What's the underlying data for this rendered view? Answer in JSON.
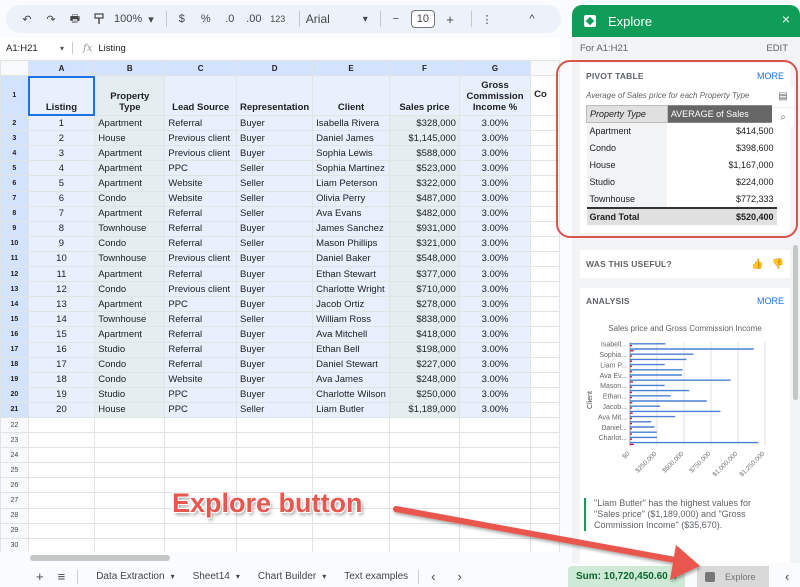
{
  "toolbar": {
    "undo": "↶",
    "redo": "↷",
    "print": "🖶",
    "paint_format": "⌨",
    "zoom": "100%",
    "currency": "$",
    "percent": "%",
    "decrease_decimal": ".0",
    "increase_decimal": ".00",
    "more_formats": "123",
    "font": "Arial",
    "font_size": "10",
    "minus": "−",
    "plus": "+",
    "more": "⋮",
    "collapse": "^"
  },
  "formula_bar": {
    "name_box": "A1:H21",
    "fx": "fx",
    "content": "Listing"
  },
  "grid": {
    "columns": [
      "A",
      "B",
      "C",
      "D",
      "E",
      "F",
      "G",
      ""
    ],
    "headers": [
      "Listing",
      "Property Type",
      "Lead Source",
      "Representation",
      "Client",
      "Sales price",
      "Gross Commission Income %",
      "Co"
    ],
    "rows": [
      [
        "1",
        "Apartment",
        "Referral",
        "Buyer",
        "Isabella Rivera",
        "$328,000",
        "3.00%"
      ],
      [
        "2",
        "House",
        "Previous client",
        "Buyer",
        "Daniel James",
        "$1,145,000",
        "3.00%"
      ],
      [
        "3",
        "Apartment",
        "Previous client",
        "Buyer",
        "Sophia Lewis",
        "$588,000",
        "3.00%"
      ],
      [
        "4",
        "Apartment",
        "PPC",
        "Seller",
        "Sophia Martinez",
        "$523,000",
        "3.00%"
      ],
      [
        "5",
        "Apartment",
        "Website",
        "Seller",
        "Liam Peterson",
        "$322,000",
        "3.00%"
      ],
      [
        "6",
        "Condo",
        "Website",
        "Seller",
        "Olivia Perry",
        "$487,000",
        "3.00%"
      ],
      [
        "7",
        "Apartment",
        "Referral",
        "Seller",
        "Ava Evans",
        "$482,000",
        "3.00%"
      ],
      [
        "8",
        "Townhouse",
        "Referral",
        "Buyer",
        "James Sanchez",
        "$931,000",
        "3.00%"
      ],
      [
        "9",
        "Condo",
        "Referral",
        "Seller",
        "Mason Phillips",
        "$321,000",
        "3.00%"
      ],
      [
        "10",
        "Townhouse",
        "Previous client",
        "Buyer",
        "Daniel Baker",
        "$548,000",
        "3.00%"
      ],
      [
        "11",
        "Apartment",
        "Referral",
        "Buyer",
        "Ethan Stewart",
        "$377,000",
        "3.00%"
      ],
      [
        "12",
        "Condo",
        "Previous client",
        "Buyer",
        "Charlotte Wright",
        "$710,000",
        "3.00%"
      ],
      [
        "13",
        "Apartment",
        "PPC",
        "Buyer",
        "Jacob Ortiz",
        "$278,000",
        "3.00%"
      ],
      [
        "14",
        "Townhouse",
        "Referral",
        "Seller",
        "William Ross",
        "$838,000",
        "3.00%"
      ],
      [
        "15",
        "Apartment",
        "Referral",
        "Buyer",
        "Ava Mitchell",
        "$418,000",
        "3.00%"
      ],
      [
        "16",
        "Studio",
        "Referral",
        "Buyer",
        "Ethan Bell",
        "$198,000",
        "3.00%"
      ],
      [
        "17",
        "Condo",
        "Referral",
        "Buyer",
        "Daniel Stewart",
        "$227,000",
        "3.00%"
      ],
      [
        "18",
        "Condo",
        "Website",
        "Buyer",
        "Ava James",
        "$248,000",
        "3.00%"
      ],
      [
        "19",
        "Studio",
        "PPC",
        "Buyer",
        "Charlotte Wilson",
        "$250,000",
        "3.00%"
      ],
      [
        "20",
        "House",
        "PPC",
        "Seller",
        "Liam Butler",
        "$1,189,000",
        "3.00%"
      ]
    ],
    "empty_row_numbers": [
      "22",
      "23",
      "24",
      "25",
      "26",
      "27",
      "28",
      "29",
      "30"
    ]
  },
  "explore": {
    "title": "Explore",
    "close": "×",
    "for_range": "For A1:H21",
    "edit": "EDIT",
    "pivot": {
      "title": "PIVOT TABLE",
      "more": "MORE",
      "subtitle": "Average of Sales price for each Property Type",
      "col1": "Property Type",
      "col2": "AVERAGE of Sales",
      "rows": [
        [
          "Apartment",
          "$414,500"
        ],
        [
          "Condo",
          "$398,600"
        ],
        [
          "House",
          "$1,167,000"
        ],
        [
          "Studio",
          "$224,000"
        ],
        [
          "Townhouse",
          "$772,333"
        ]
      ],
      "total_label": "Grand Total",
      "total_value": "$520,400"
    },
    "useful": {
      "question": "WAS THIS USEFUL?",
      "thumbs_up": "👍",
      "thumbs_down": "👎"
    },
    "analysis": {
      "title": "ANALYSIS",
      "more": "MORE",
      "insight": "\"Liam Butler\" has the highest values for \"Sales price\" ($1,189,000) and \"Gross Commission Income\" ($35,670)."
    }
  },
  "chart_data": {
    "type": "bar",
    "orientation": "horizontal",
    "title": "Sales price and Gross Commission Income",
    "xlabel": "",
    "ylabel": "Client",
    "visible_category_labels": [
      "Isabell...",
      "Sophia...",
      "Liam P...",
      "Ava Ev...",
      "Mason...",
      "Ethan...",
      "Jacob...",
      "Ava Mit...",
      "Daniel...",
      "Charlot..."
    ],
    "categories": [
      "Isabella Rivera",
      "Daniel James",
      "Sophia Lewis",
      "Sophia Martinez",
      "Liam Peterson",
      "Olivia Perry",
      "Ava Evans",
      "James Sanchez",
      "Mason Phillips",
      "Daniel Baker",
      "Ethan Stewart",
      "Charlotte Wright",
      "Jacob Ortiz",
      "William Ross",
      "Ava Mitchell",
      "Ethan Bell",
      "Daniel Stewart",
      "Ava James",
      "Charlotte Wilson",
      "Liam Butler"
    ],
    "series": [
      {
        "name": "Sales price",
        "color": "#4a7fd4",
        "values": [
          328000,
          1145000,
          588000,
          523000,
          322000,
          487000,
          482000,
          931000,
          321000,
          548000,
          377000,
          710000,
          278000,
          838000,
          418000,
          198000,
          227000,
          248000,
          250000,
          1189000
        ]
      },
      {
        "name": "Gross Commission Income",
        "color": "#c2185b",
        "values": [
          9840,
          34350,
          17640,
          15690,
          9660,
          14610,
          14460,
          27930,
          9630,
          16440,
          11310,
          21300,
          8340,
          25140,
          12540,
          5940,
          6810,
          7440,
          7500,
          35670
        ]
      }
    ],
    "xticks": [
      "$0",
      "$250,000",
      "$500,000",
      "$750,000",
      "$1,000,000",
      "$1,250,000"
    ],
    "xlim": [
      0,
      1250000
    ],
    "grid": true,
    "legend": "none"
  },
  "bottom": {
    "add": "+",
    "all_sheets": "≡",
    "sheets": [
      "Data Extraction",
      "Sheet14",
      "Chart Builder",
      "Text examples"
    ],
    "prev": "‹",
    "next": "›",
    "sum": "Sum: 10,720,450.60",
    "explore_label": "Explore",
    "collapse": "‹"
  },
  "annotation": {
    "text": "Explore button",
    "color": "#e8574e"
  }
}
